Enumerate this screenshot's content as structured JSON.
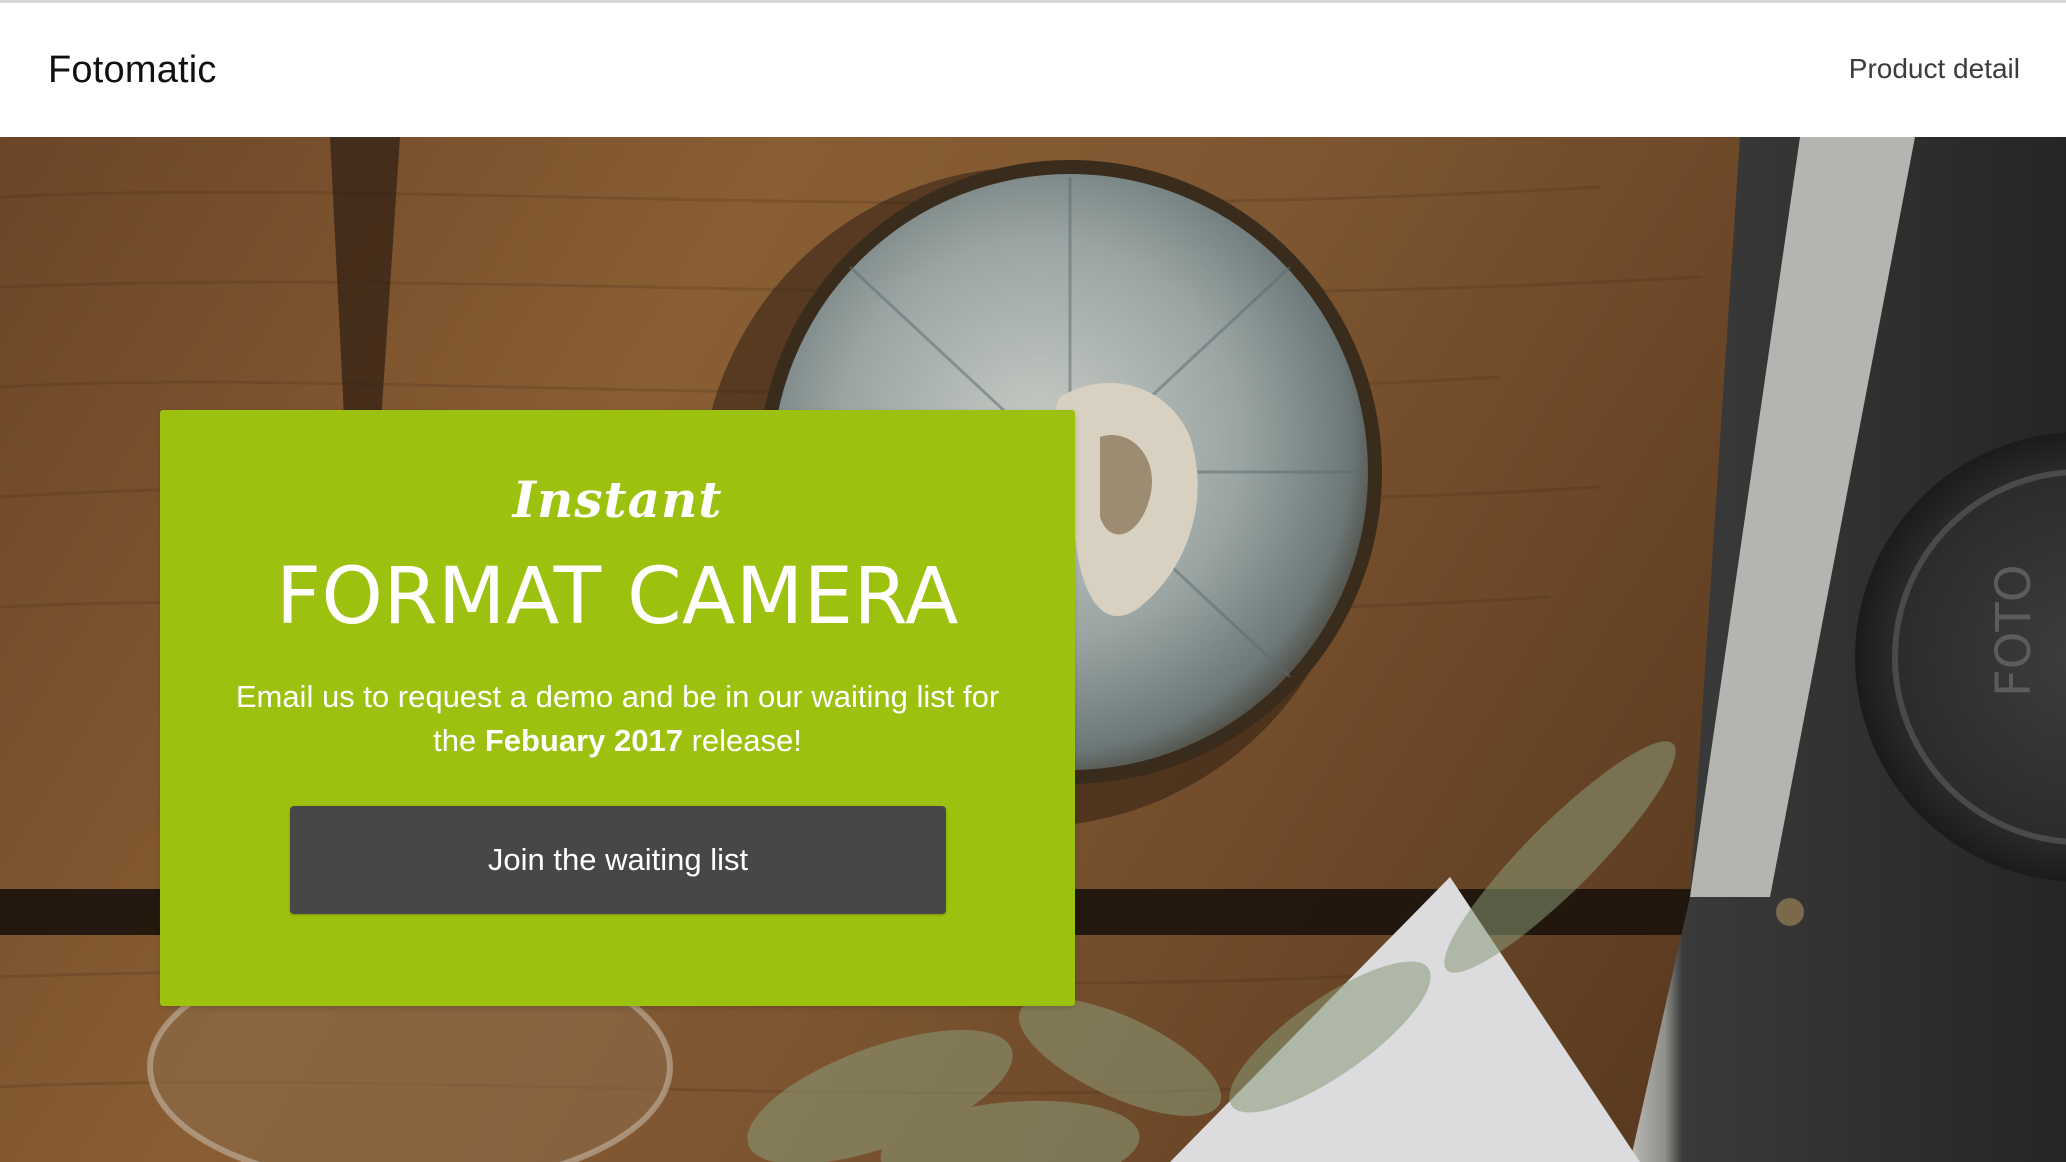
{
  "header": {
    "brand": "Fotomatic",
    "nav_link": "Product detail"
  },
  "hero": {
    "card": {
      "kicker": "Instant",
      "headline": "FORMAT CAMERA",
      "desc_before": "Email us to request a demo and be in our waiting list for the ",
      "desc_bold": "Febuary 2017",
      "desc_after": " release!",
      "cta_label": "Join the waiting list"
    },
    "lens_cap_text": "FOTO"
  },
  "colors": {
    "card_green": "#9dc10f",
    "button_dark": "#474747",
    "header_bg": "#ffffff"
  }
}
